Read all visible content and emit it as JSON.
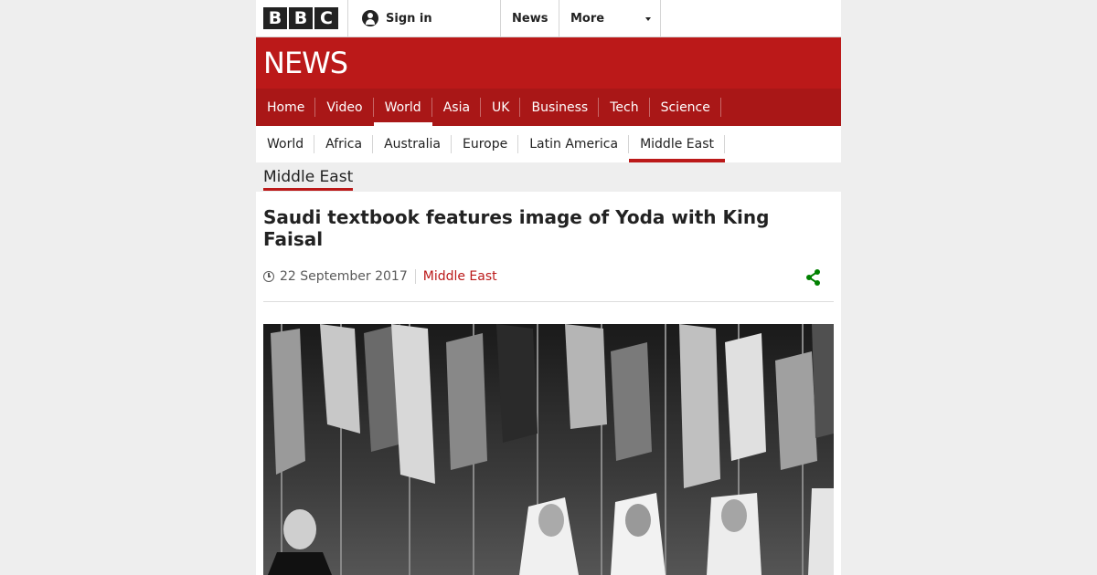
{
  "brand": {
    "bbc_letters": [
      "B",
      "B",
      "C"
    ],
    "news_wordmark": "NEWS",
    "accent_color": "#bb1919"
  },
  "topbar": {
    "signin_label": "Sign in",
    "nav": [
      "News",
      "More"
    ]
  },
  "primary_nav": {
    "items": [
      "Home",
      "Video",
      "World",
      "Asia",
      "UK",
      "Business",
      "Tech",
      "Science"
    ],
    "active": "World"
  },
  "secondary_nav": {
    "items": [
      "World",
      "Africa",
      "Australia",
      "Europe",
      "Latin America",
      "Middle East"
    ],
    "active": "Middle East"
  },
  "section_label": "Middle East",
  "article": {
    "headline": "Saudi textbook features image of Yoda with King Faisal",
    "date": "22 September 2017",
    "section": "Middle East",
    "share_icon": "share-icon",
    "share_color": "#008000"
  }
}
